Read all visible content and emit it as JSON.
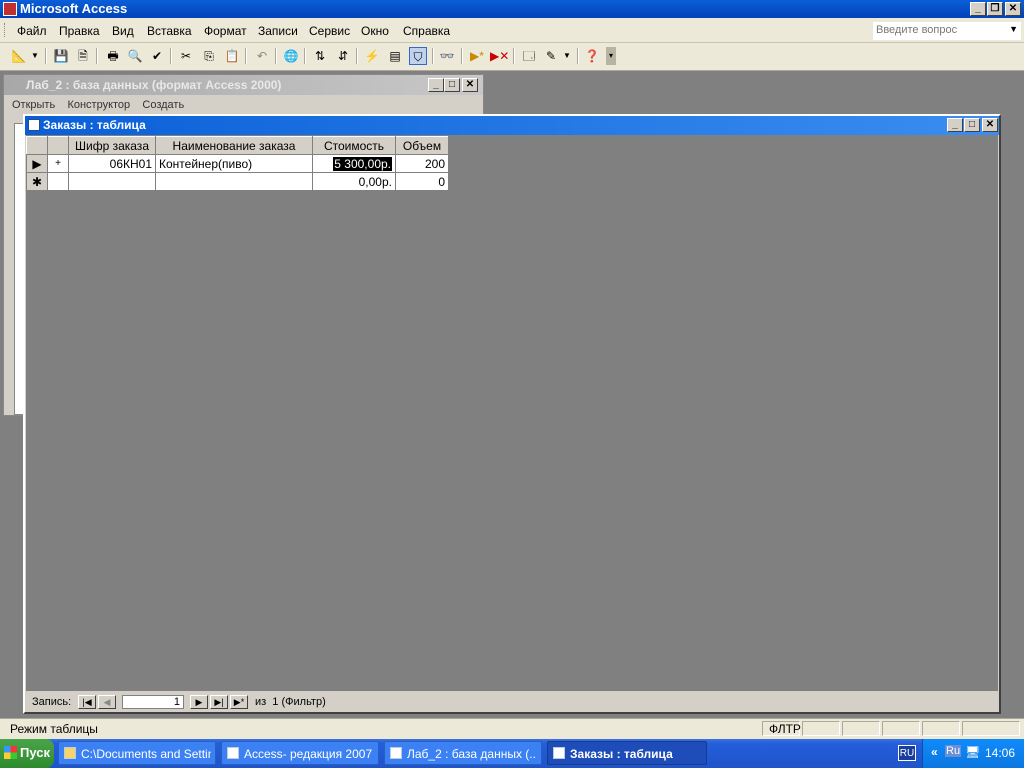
{
  "app": {
    "title": "Microsoft Access"
  },
  "menu": {
    "items": [
      "Файл",
      "Правка",
      "Вид",
      "Вставка",
      "Формат",
      "Записи",
      "Сервис",
      "Окно",
      "Справка"
    ],
    "help_placeholder": "Введите вопрос"
  },
  "db_window": {
    "title": "Лаб_2 : база данных (формат Access 2000)",
    "toolbar": {
      "open": "Открыть",
      "design": "Конструктор",
      "create": "Создать"
    }
  },
  "table_window": {
    "title": "Заказы : таблица",
    "columns": [
      "Шифр заказа",
      "Наименование заказа",
      "Стоимость",
      "Объем"
    ],
    "rows": [
      {
        "code": "06КН01",
        "name": "Контейнер(пиво)",
        "cost": "5 300,00р.",
        "volume": "200"
      }
    ],
    "new_row": {
      "cost": "0,00р.",
      "volume": "0"
    },
    "nav": {
      "record_label": "Запись:",
      "current": "1",
      "of_label": "из  1 (Фильтр)"
    }
  },
  "status": {
    "mode": "Режим таблицы",
    "filter": "ФЛТР"
  },
  "taskbar": {
    "start": "Пуск",
    "tasks": [
      "C:\\Documents and Settin...",
      "Access- редакция 2007 ...",
      "Лаб_2 : база данных (...",
      "Заказы : таблица"
    ],
    "lang": "RU",
    "tray_lang": "Ru",
    "time": "14:06"
  }
}
